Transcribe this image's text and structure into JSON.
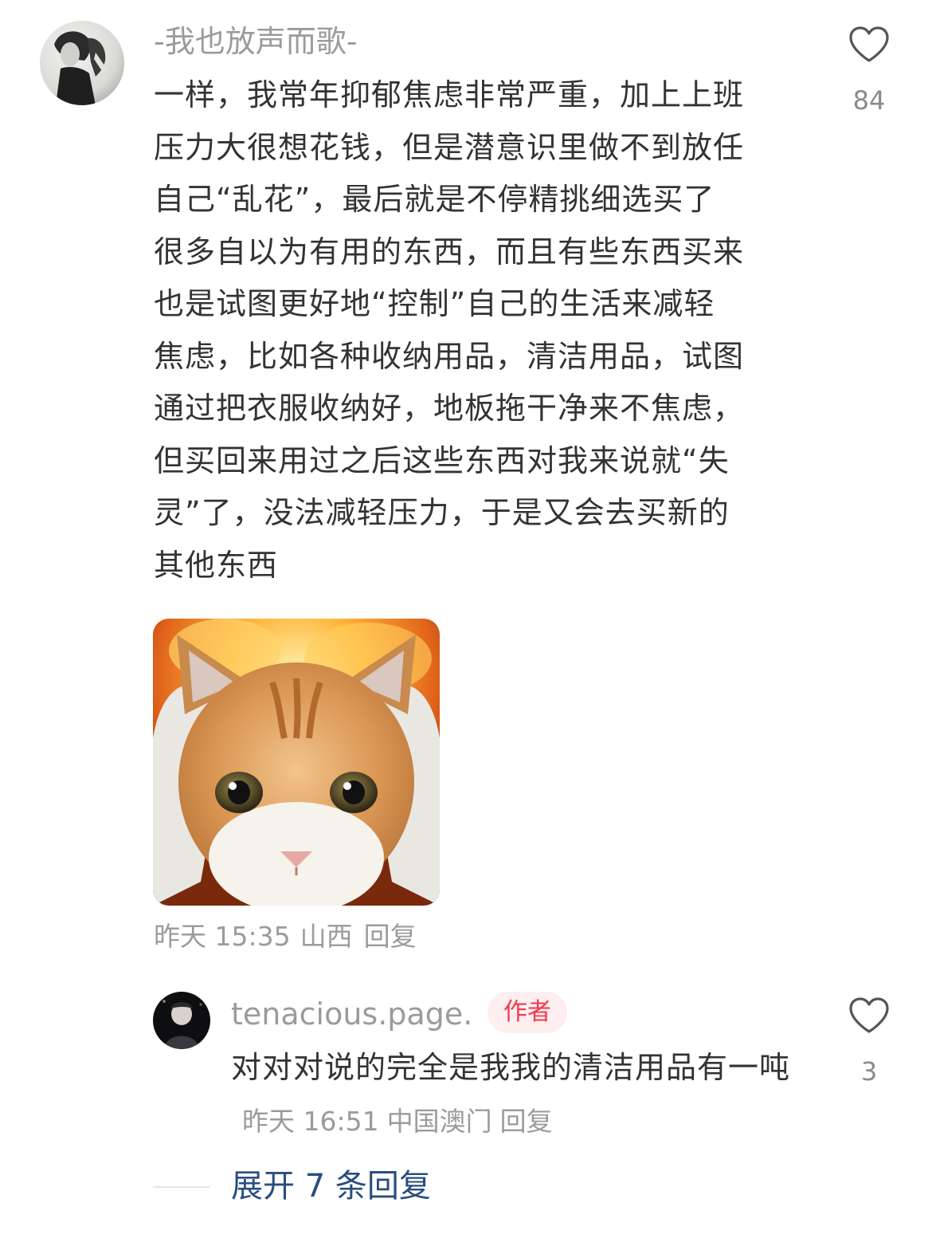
{
  "comment": {
    "username": "-我也放声而歌-",
    "text": "一样，我常年抑郁焦虑非常严重，加上上班\n压力大很想花钱，但是潜意识里做不到放任\n自己“乱花”，最后就是不停精挑细选买了\n很多自以为有用的东西，而且有些东西买来\n也是试图更好地“控制”自己的生活来减轻\n焦虑，比如各种收纳用品，清洁用品，试图\n通过把衣服收纳好，地板拖干净来不焦虑，\n但买回来用过之后这些东西对我来说就“失\n灵”了，没法减轻压力，于是又会去买新的\n其他东西",
    "time": "昨天 15:35",
    "location": "山西",
    "reply_label": "回复",
    "like_count": "84",
    "like_icon": "heart-outline-icon",
    "sticker": "cat-covering-ears-sticker"
  },
  "reply": {
    "username": "tenacious.page.",
    "badge": "作者",
    "text": "对对对说的完全是我我的清洁用品有一吨",
    "time": "昨天 16:51",
    "location": "中国澳门",
    "reply_label": "回复",
    "like_count": "3",
    "like_icon": "heart-outline-icon"
  },
  "expand": {
    "label": "展开 7 条回复"
  },
  "colors": {
    "username": "#9b9b9b",
    "text": "#333333",
    "badge_text": "#f2374b",
    "badge_bg": "#fdeef0",
    "expand_link": "#2a4d7f"
  }
}
